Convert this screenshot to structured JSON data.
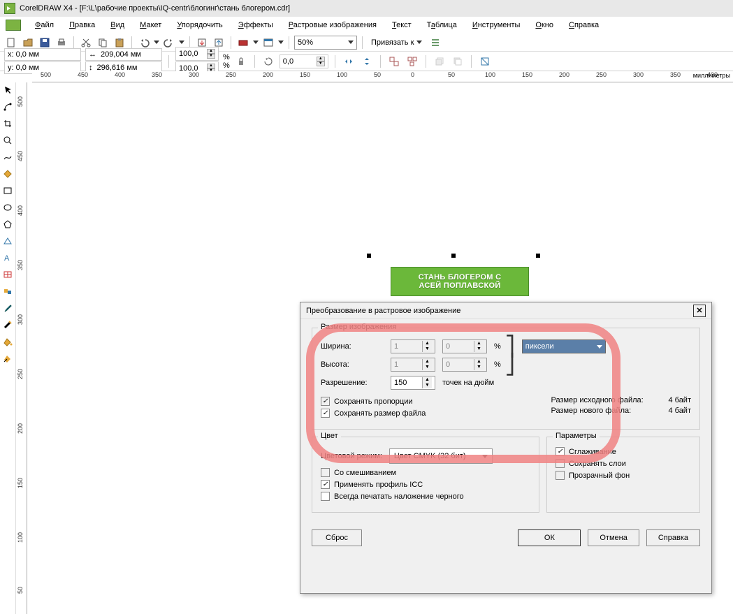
{
  "title": "CorelDRAW X4 - [F:\\L\\рабочие проекты\\IQ-centr\\блогинг\\стань блогером.cdr]",
  "menu": {
    "file": "Файл",
    "edit": "Правка",
    "view": "Вид",
    "layout": "Макет",
    "arrange": "Упорядочить",
    "effects": "Эффекты",
    "bitmaps": "Растровые изображения",
    "text": "Текст",
    "table": "Таблица",
    "tools": "Инструменты",
    "window": "Окно",
    "help": "Справка"
  },
  "toolbar": {
    "zoom": "50%",
    "snap": "Привязать к"
  },
  "props": {
    "x": "x: 0,0 мм",
    "y": "y: 0,0 мм",
    "width": "209,004 мм",
    "height": "296,616 мм",
    "sx": "100,0",
    "sy": "100,0",
    "rot": "0,0"
  },
  "ruler": {
    "h": [
      "500",
      "450",
      "400",
      "350",
      "300",
      "250",
      "200",
      "150",
      "100",
      "50",
      "0",
      "50",
      "100",
      "150",
      "200",
      "250",
      "300",
      "350",
      "400"
    ],
    "v": [
      "500",
      "450",
      "400",
      "350",
      "300",
      "250",
      "200",
      "150",
      "100",
      "50"
    ],
    "unit": "миллиметры"
  },
  "banner": {
    "line1": "СТАНЬ БЛОГЕРОМ С",
    "line2": "АСЕЙ ПОПЛАВСКОЙ"
  },
  "dialog": {
    "title": "Преобразование в растровое изображение",
    "size_legend": "Размер изображения",
    "width_lbl": "Ширина:",
    "width_v": "1",
    "width_p": "0",
    "height_lbl": "Высота:",
    "height_v": "1",
    "height_p": "0",
    "pct": "%",
    "res_lbl": "Разрешение:",
    "res_v": "150",
    "res_u": "точек на дюйм",
    "unit": "пиксели",
    "cb_aspect": "Сохранять пропорции",
    "cb_filesize": "Сохранять размер файла",
    "orig_lbl": "Размер исходного файла:",
    "orig_v": "4 байт",
    "new_lbl": "Размер нового файла:",
    "new_v": "4 байт",
    "color_legend": "Цвет",
    "colormode_lbl": "Цветовой режим:",
    "colormode_v": "Цвет CMYK (32 бит)",
    "cb_dither": "Со смешиванием",
    "cb_icc": "Применять профиль ICC",
    "cb_overprint": "Всегда печатать наложение черного",
    "param_legend": "Параметры",
    "cb_aa": "Сглаживание",
    "cb_layers": "Сохранять слои",
    "cb_transp": "Прозрачный фон",
    "reset": "Сброс",
    "ok": "ОК",
    "cancel": "Отмена",
    "help": "Справка"
  }
}
